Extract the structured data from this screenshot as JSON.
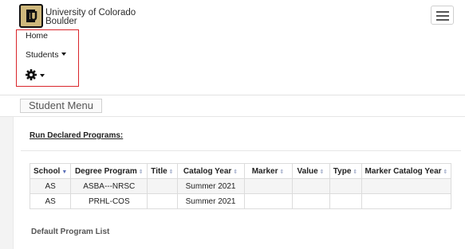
{
  "brand": {
    "line1": "University of Colorado",
    "line2": "Boulder"
  },
  "nav": {
    "home": "Home",
    "students": "Students"
  },
  "student_menu": "Student Menu",
  "run_declared": "Run Declared Programs:",
  "table": {
    "headers": [
      {
        "label": "School",
        "sort_glyph": "▼"
      },
      {
        "label": "Degree Program",
        "sort_glyph": "⇕"
      },
      {
        "label": "Title",
        "sort_glyph": "⇕"
      },
      {
        "label": "Catalog Year",
        "sort_glyph": "⇕"
      },
      {
        "label": "Marker",
        "sort_glyph": "⇕"
      },
      {
        "label": "Value",
        "sort_glyph": "⇕"
      },
      {
        "label": "Type",
        "sort_glyph": "⇕"
      },
      {
        "label": "Marker Catalog Year",
        "sort_glyph": "⇕"
      }
    ],
    "rows": [
      [
        "AS",
        "ASBA---NRSC",
        "",
        "Summer 2021",
        "",
        "",
        "",
        ""
      ],
      [
        "AS",
        "PRHL-COS",
        "",
        "Summer 2021",
        "",
        "",
        "",
        ""
      ]
    ]
  },
  "default_program_list": "Default Program List",
  "colors": {
    "cu_gold": "#cfb87c",
    "highlight_red": "#d9252b"
  }
}
